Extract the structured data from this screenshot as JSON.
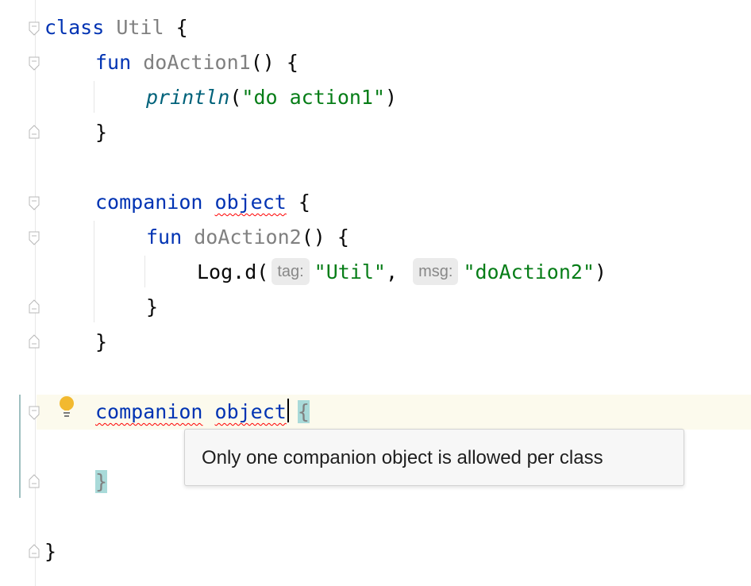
{
  "editor": {
    "line1": {
      "kw": "class",
      "name": "Util",
      "brace": "{"
    },
    "line2": {
      "kw": "fun",
      "name": "doAction1",
      "rest": "() {"
    },
    "line3": {
      "fn": "println",
      "open": "(",
      "str": "\"do action1\"",
      "close": ")"
    },
    "line4": {
      "brace": "}"
    },
    "line6": {
      "kw1": "companion",
      "kw2": "object",
      "brace": "{"
    },
    "line7": {
      "kw": "fun",
      "name": "doAction2",
      "rest": "() {"
    },
    "line8": {
      "call": "Log.d(",
      "hint1": "tag:",
      "str1": "\"Util\"",
      "comma": ",",
      "hint2": "msg:",
      "str2": "\"doAction2\"",
      "close": ")"
    },
    "line9": {
      "brace": "}"
    },
    "line10": {
      "brace": "}"
    },
    "line12": {
      "kw1": "companion",
      "kw2": "object",
      "brace": "{"
    },
    "line14": {
      "brace": "}"
    },
    "line16": {
      "brace": "}"
    }
  },
  "tooltip": {
    "message": "Only one companion object is allowed per class"
  },
  "icons": {
    "fold_marker": "fold-marker-icon",
    "lightbulb": "lightbulb-icon"
  },
  "colors": {
    "keyword": "#0033b3",
    "string": "#067d17",
    "declaration": "#808080",
    "error": "#ff0000",
    "brace_match": "#a9dad9",
    "current_line": "#fcfaed",
    "lightbulb": "#f2b92f"
  }
}
